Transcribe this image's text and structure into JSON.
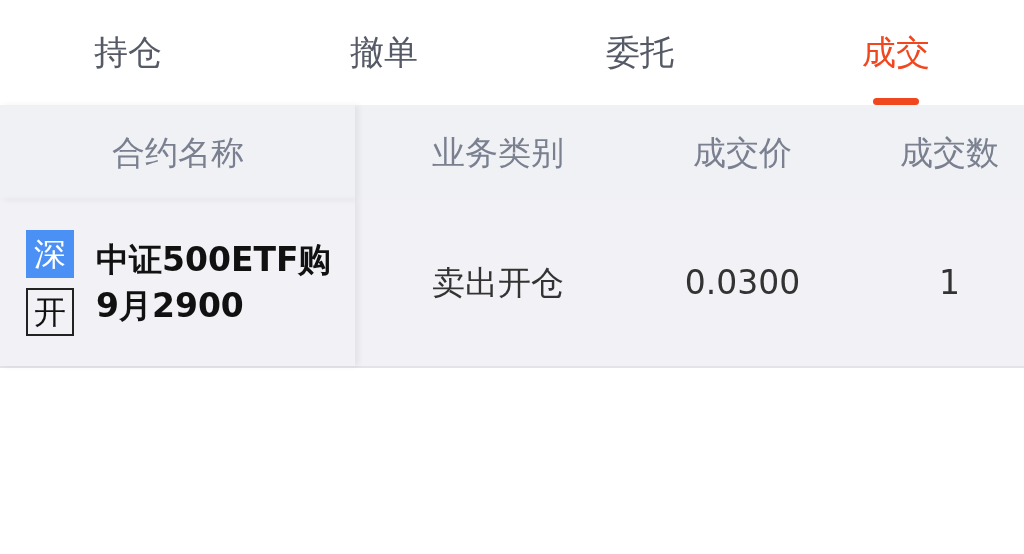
{
  "tabs": [
    {
      "label": "持仓",
      "selected": false
    },
    {
      "label": "撤单",
      "selected": false
    },
    {
      "label": "委托",
      "selected": false
    },
    {
      "label": "成交",
      "selected": true
    }
  ],
  "table": {
    "columns": [
      "合约名称",
      "业务类别",
      "成交价",
      "成交数"
    ],
    "rows": [
      {
        "cells": [
          {
            "kind": "contract",
            "tags": [
              {
                "text": "深",
                "kind": "filled"
              },
              {
                "text": "开",
                "kind": "outlined"
              }
            ],
            "lines": [
              "中证500ETF购",
              "9月2900"
            ]
          },
          {
            "kind": "text",
            "text": "卖出开仓"
          },
          {
            "kind": "text",
            "text": "0.0300"
          },
          {
            "kind": "text",
            "text": "1"
          }
        ]
      }
    ]
  }
}
